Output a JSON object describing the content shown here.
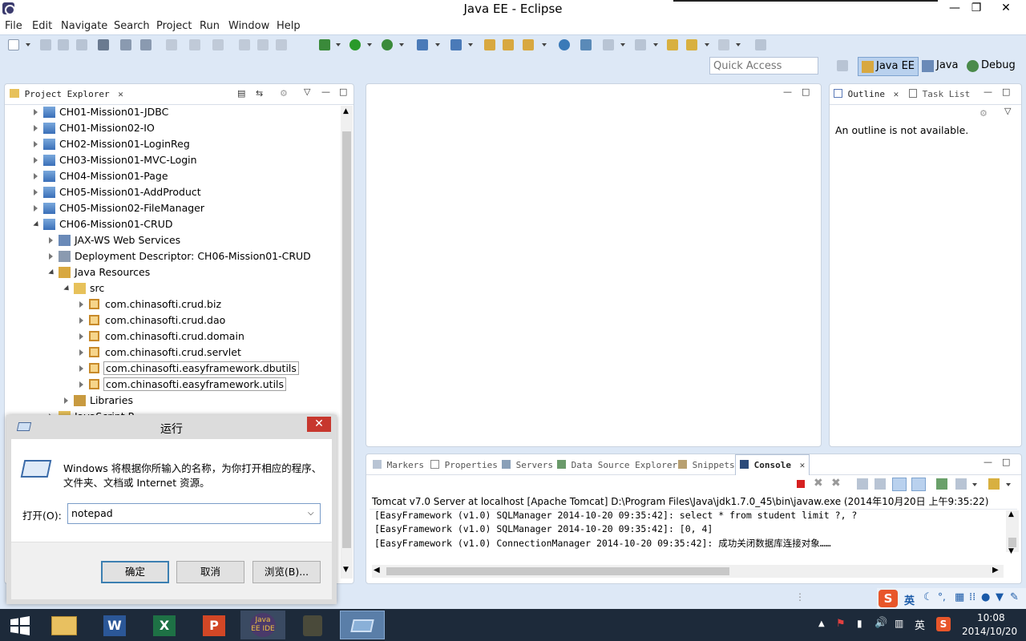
{
  "window": {
    "title": "Java EE - Eclipse",
    "minimize": "—",
    "restore": "❐",
    "close": "✕"
  },
  "menu": [
    "File",
    "Edit",
    "Navigate",
    "Search",
    "Project",
    "Run",
    "Window",
    "Help"
  ],
  "toolbar": {
    "quick_access_placeholder": "Quick Access",
    "perspectives": [
      {
        "label": "Java EE",
        "icon": "javaee-perspective-icon",
        "active": true
      },
      {
        "label": "Java",
        "icon": "java-perspective-icon",
        "active": false
      },
      {
        "label": "Debug",
        "icon": "debug-perspective-icon",
        "active": false
      }
    ]
  },
  "project_explorer": {
    "tab_label": "Project Explorer",
    "tree": [
      {
        "label": "CH01-Mission01-JDBC",
        "depth": 0,
        "expanded": false,
        "icon": "project-icon"
      },
      {
        "label": "CH01-Mission02-IO",
        "depth": 0,
        "expanded": false,
        "icon": "project-icon"
      },
      {
        "label": "CH02-Mission01-LoginReg",
        "depth": 0,
        "expanded": false,
        "icon": "project-icon"
      },
      {
        "label": "CH03-Mission01-MVC-Login",
        "depth": 0,
        "expanded": false,
        "icon": "project-icon"
      },
      {
        "label": "CH04-Mission01-Page",
        "depth": 0,
        "expanded": false,
        "icon": "project-icon"
      },
      {
        "label": "CH05-Mission01-AddProduct",
        "depth": 0,
        "expanded": false,
        "icon": "project-icon"
      },
      {
        "label": "CH05-Mission02-FileManager",
        "depth": 0,
        "expanded": false,
        "icon": "project-icon"
      },
      {
        "label": "CH06-Mission01-CRUD",
        "depth": 0,
        "expanded": true,
        "icon": "project-icon"
      },
      {
        "label": "JAX-WS Web Services",
        "depth": 1,
        "expanded": false,
        "icon": "webservice-icon"
      },
      {
        "label": "Deployment Descriptor: CH06-Mission01-CRUD",
        "depth": 1,
        "expanded": false,
        "icon": "descriptor-icon"
      },
      {
        "label": "Java Resources",
        "depth": 1,
        "expanded": true,
        "icon": "java-resources-icon"
      },
      {
        "label": "src",
        "depth": 2,
        "expanded": true,
        "icon": "source-folder-icon"
      },
      {
        "label": "com.chinasofti.crud.biz",
        "depth": 3,
        "expanded": false,
        "icon": "package-icon"
      },
      {
        "label": "com.chinasofti.crud.dao",
        "depth": 3,
        "expanded": false,
        "icon": "package-icon"
      },
      {
        "label": "com.chinasofti.crud.domain",
        "depth": 3,
        "expanded": false,
        "icon": "package-icon"
      },
      {
        "label": "com.chinasofti.crud.servlet",
        "depth": 3,
        "expanded": false,
        "icon": "package-icon"
      },
      {
        "label": "com.chinasofti.easyframework.dbutils",
        "depth": 3,
        "expanded": false,
        "icon": "package-icon",
        "boxed": true
      },
      {
        "label": "com.chinasofti.easyframework.utils",
        "depth": 3,
        "expanded": false,
        "icon": "package-icon",
        "boxed": true
      },
      {
        "label": "Libraries",
        "depth": 2,
        "expanded": false,
        "icon": "libraries-icon"
      },
      {
        "label": "JavaScript R...",
        "depth": 1,
        "expanded": false,
        "icon": "folder-icon"
      }
    ]
  },
  "outline": {
    "tabs": [
      {
        "label": "Outline",
        "active": true
      },
      {
        "label": "Task List",
        "active": false
      }
    ],
    "message": "An outline is not available."
  },
  "bottom_panel": {
    "tabs": [
      {
        "label": "Markers",
        "active": false
      },
      {
        "label": "Properties",
        "active": false
      },
      {
        "label": "Servers",
        "active": false
      },
      {
        "label": "Data Source Explorer",
        "active": false
      },
      {
        "label": "Snippets",
        "active": false
      },
      {
        "label": "Console",
        "active": true
      }
    ],
    "console_header": "Tomcat v7.0 Server at localhost [Apache Tomcat] D:\\Program Files\\Java\\jdk1.7.0_45\\bin\\javaw.exe (2014年10月20日 上午9:35:22)",
    "console_lines": [
      "[EasyFramework (v1.0) SQLManager 2014-10-20 09:35:42]: select * from student limit ?, ?",
      "[EasyFramework (v1.0) SQLManager 2014-10-20 09:35:42]: [0, 4]",
      "[EasyFramework (v1.0) ConnectionManager 2014-10-20 09:35:42]: 成功关闭数据库连接对象……"
    ]
  },
  "run_dialog": {
    "title": "运行",
    "description_line1": "Windows 将根据你所输入的名称，为你打开相应的程序、",
    "description_line2": "文件夹、文档或 Internet 资源。",
    "open_label": "打开(O):",
    "open_value": "notepad",
    "ok": "确定",
    "cancel": "取消",
    "browse": "浏览(B)...",
    "close": "✕"
  },
  "taskbar": {
    "apps": [
      {
        "name": "start-button",
        "active": false
      },
      {
        "name": "file-explorer",
        "active": false
      },
      {
        "name": "word",
        "active": false
      },
      {
        "name": "excel",
        "active": false
      },
      {
        "name": "powerpoint",
        "active": false
      },
      {
        "name": "java-ee-ide",
        "active": false,
        "label": "Java EE IDE"
      },
      {
        "name": "camera-app",
        "active": false
      },
      {
        "name": "run-dialog-app",
        "active": true
      }
    ],
    "ime_label": "英",
    "tray_lang": "英",
    "time": "10:08",
    "date": "2014/10/20"
  },
  "colors": {
    "toolbar_bg": "#dde8f6",
    "taskbar_bg": "#1d2a3a",
    "dialog_close": "#c7372e",
    "console_stop": "#d62020"
  }
}
